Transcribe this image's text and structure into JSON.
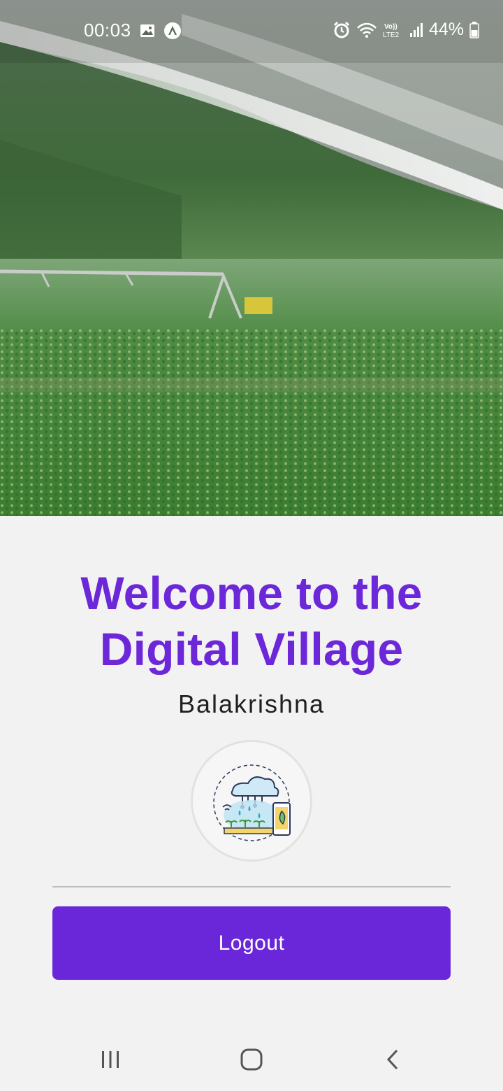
{
  "status_bar": {
    "time": "00:03",
    "battery": "44%",
    "network": "LTE2",
    "icons": [
      "gallery-icon",
      "app-notification-icon",
      "alarm-icon",
      "wifi-icon",
      "volte-icon",
      "signal-icon",
      "battery-icon"
    ]
  },
  "hero": {
    "image": "irrigation-field-photo"
  },
  "main": {
    "title_line1": "Welcome to the",
    "title_line2": "Digital Village",
    "user_name": "Balakrishna",
    "logo": "smart-farming-logo",
    "logout_label": "Logout"
  },
  "nav": {
    "recents": "recents-icon",
    "home": "home-icon",
    "back": "back-icon"
  },
  "colors": {
    "accent": "#6c27d9",
    "button": "#6a27d9",
    "background": "#f2f2f2"
  }
}
